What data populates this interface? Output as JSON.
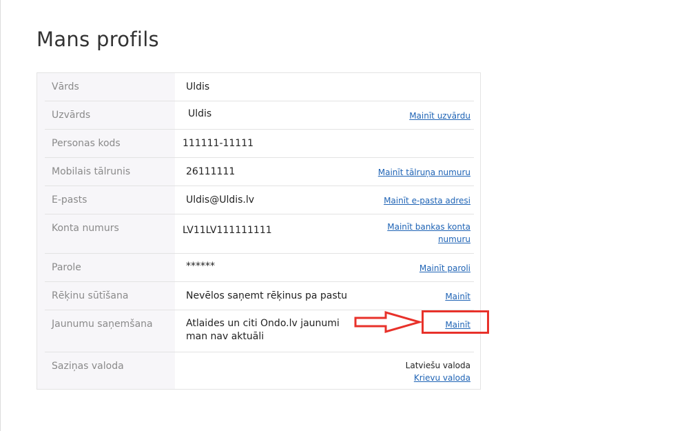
{
  "page": {
    "title": "Mans profils"
  },
  "profile": {
    "rows": [
      {
        "label": "Vārds",
        "value": "Uldis"
      },
      {
        "label": "Uzvārds",
        "value": "Uldis",
        "action": "Mainīt uzvārdu"
      },
      {
        "label": "Personas kods",
        "value": "111111-11111"
      },
      {
        "label": "Mobilais tālrunis",
        "value": "26111111",
        "action": "Mainīt tālruņa numuru"
      },
      {
        "label": "E-pasts",
        "value": "Uldis@Uldis.lv",
        "action": "Mainīt e-pasta adresi"
      },
      {
        "label": "Konta numurs",
        "value": "LV11LV111111111",
        "action": "Mainīt bankas konta numuru"
      },
      {
        "label": "Parole",
        "value": "******",
        "action": "Mainīt paroli"
      },
      {
        "label": "Rēķinu sūtīšana",
        "value": "Nevēlos saņemt rēķinus pa pastu",
        "action": "Mainīt"
      },
      {
        "label": "Jaunumu saņemšana",
        "value": "Atlaides un citi Ondo.lv jaunumi man nav aktuāli",
        "action": "Mainīt"
      },
      {
        "label": "Saziņas valoda",
        "current": "Latviešu valoda",
        "alternative": "Krievu valoda"
      }
    ]
  },
  "annotation": {
    "color": "#e8312a"
  }
}
